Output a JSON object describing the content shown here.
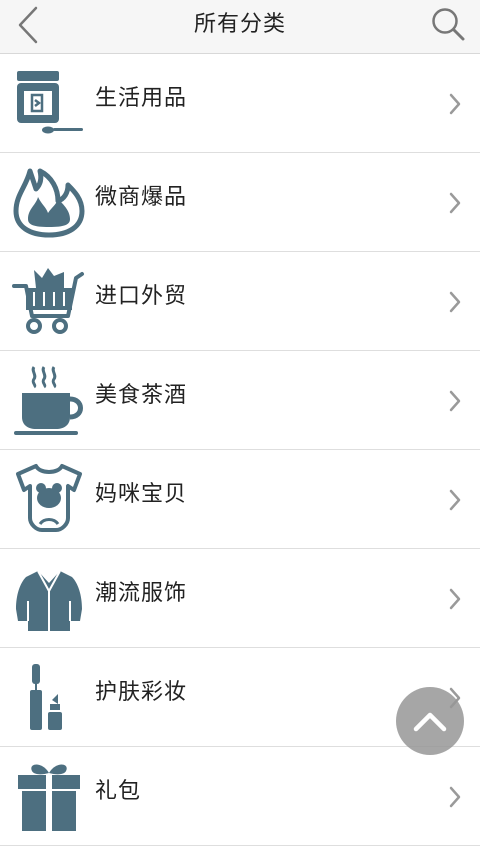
{
  "header": {
    "title": "所有分类",
    "back_icon": "chevron-left-icon",
    "search_icon": "search-icon"
  },
  "categories": [
    {
      "label": "生活用品",
      "icon": "jar-spoon-icon"
    },
    {
      "label": "微商爆品",
      "icon": "flame-icon"
    },
    {
      "label": "进口外贸",
      "icon": "shopping-cart-icon"
    },
    {
      "label": "美食茶酒",
      "icon": "tea-cup-icon"
    },
    {
      "label": "妈咪宝贝",
      "icon": "baby-onesie-icon"
    },
    {
      "label": "潮流服饰",
      "icon": "jacket-icon"
    },
    {
      "label": "护肤彩妆",
      "icon": "cosmetics-icon"
    },
    {
      "label": "礼包",
      "icon": "gift-box-icon"
    }
  ],
  "colors": {
    "icon": "#4d6f80",
    "header_bg": "#f6f6f6",
    "divider": "#dedede",
    "chevron": "#9a9a9a",
    "fab_bg": "#969696"
  },
  "fab": {
    "icon": "chevron-up-icon"
  }
}
